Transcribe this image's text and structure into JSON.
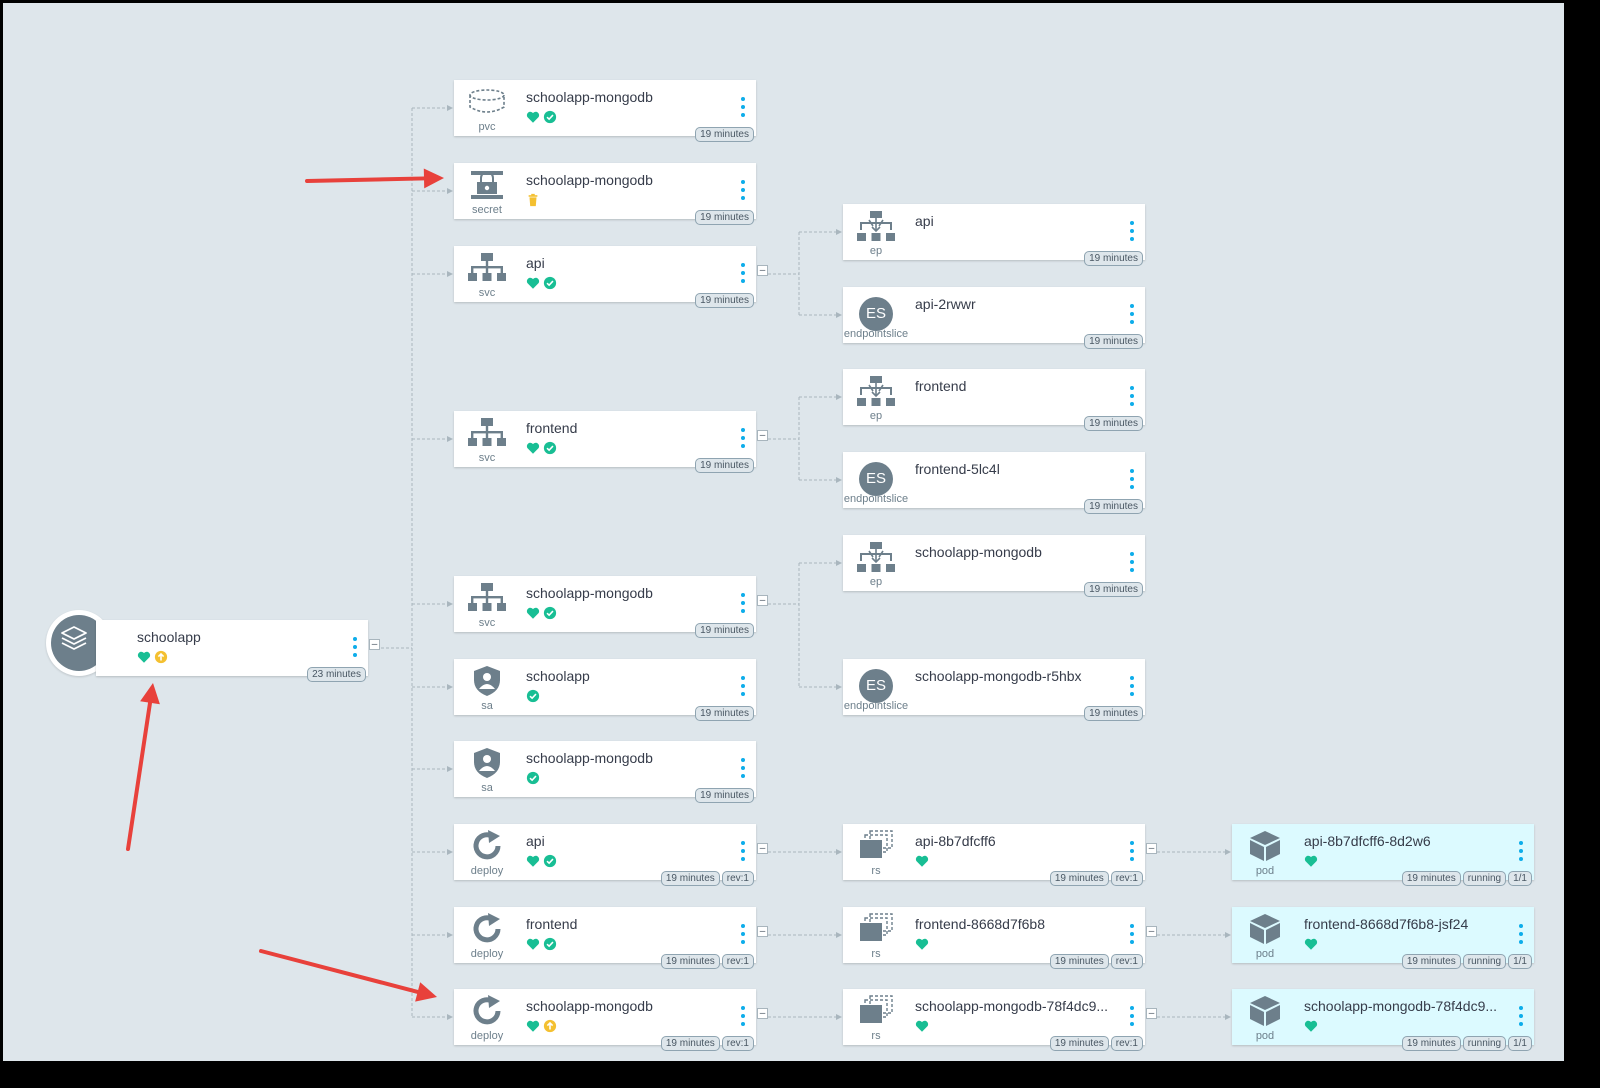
{
  "app": {
    "name": "schoolapp",
    "age": "23 minutes",
    "status": [
      "heart-icon",
      "sync-pending-icon"
    ]
  },
  "nodes": [
    {
      "id": "pvc-mongo",
      "kind": "pvc",
      "name": "schoolapp-mongodb",
      "status": [
        "heart-icon",
        "check-circle-icon"
      ],
      "tags": [
        "19 minutes"
      ]
    },
    {
      "id": "secret-mongo",
      "kind": "secret",
      "name": "schoolapp-mongodb",
      "status": [
        "trash-icon"
      ],
      "tags": [
        "19 minutes"
      ]
    },
    {
      "id": "svc-api",
      "kind": "svc",
      "name": "api",
      "status": [
        "heart-icon",
        "check-circle-icon"
      ],
      "tags": [
        "19 minutes"
      ]
    },
    {
      "id": "ep-api",
      "kind": "ep",
      "name": "api",
      "status": [],
      "tags": [
        "19 minutes"
      ]
    },
    {
      "id": "es-api",
      "kind": "endpointslice",
      "name": "api-2rwwr",
      "status": [],
      "tags": [
        "19 minutes"
      ]
    },
    {
      "id": "svc-frontend",
      "kind": "svc",
      "name": "frontend",
      "status": [
        "heart-icon",
        "check-circle-icon"
      ],
      "tags": [
        "19 minutes"
      ]
    },
    {
      "id": "ep-frontend",
      "kind": "ep",
      "name": "frontend",
      "status": [],
      "tags": [
        "19 minutes"
      ]
    },
    {
      "id": "es-frontend",
      "kind": "endpointslice",
      "name": "frontend-5lc4l",
      "status": [],
      "tags": [
        "19 minutes"
      ]
    },
    {
      "id": "svc-mongo",
      "kind": "svc",
      "name": "schoolapp-mongodb",
      "status": [
        "heart-icon",
        "check-circle-icon"
      ],
      "tags": [
        "19 minutes"
      ]
    },
    {
      "id": "ep-mongo",
      "kind": "ep",
      "name": "schoolapp-mongodb",
      "status": [],
      "tags": [
        "19 minutes"
      ]
    },
    {
      "id": "es-mongo",
      "kind": "endpointslice",
      "name": "schoolapp-mongodb-r5hbx",
      "status": [],
      "tags": [
        "19 minutes"
      ]
    },
    {
      "id": "sa-app",
      "kind": "sa",
      "name": "schoolapp",
      "status": [
        "check-circle-icon"
      ],
      "tags": [
        "19 minutes"
      ]
    },
    {
      "id": "sa-mongo",
      "kind": "sa",
      "name": "schoolapp-mongodb",
      "status": [
        "check-circle-icon"
      ],
      "tags": [
        "19 minutes"
      ]
    },
    {
      "id": "deploy-api",
      "kind": "deploy",
      "name": "api",
      "status": [
        "heart-icon",
        "check-circle-icon"
      ],
      "tags": [
        "19 minutes",
        "rev:1"
      ]
    },
    {
      "id": "rs-api",
      "kind": "rs",
      "name": "api-8b7dfcff6",
      "status": [
        "heart-icon"
      ],
      "tags": [
        "19 minutes",
        "rev:1"
      ]
    },
    {
      "id": "pod-api",
      "kind": "pod",
      "name": "api-8b7dfcff6-8d2w6",
      "status": [
        "heart-icon"
      ],
      "tags": [
        "19 minutes",
        "running",
        "1/1"
      ]
    },
    {
      "id": "deploy-frontend",
      "kind": "deploy",
      "name": "frontend",
      "status": [
        "heart-icon",
        "check-circle-icon"
      ],
      "tags": [
        "19 minutes",
        "rev:1"
      ]
    },
    {
      "id": "rs-frontend",
      "kind": "rs",
      "name": "frontend-8668d7f6b8",
      "status": [
        "heart-icon"
      ],
      "tags": [
        "19 minutes",
        "rev:1"
      ]
    },
    {
      "id": "pod-frontend",
      "kind": "pod",
      "name": "frontend-8668d7f6b8-jsf24",
      "status": [
        "heart-icon"
      ],
      "tags": [
        "19 minutes",
        "running",
        "1/1"
      ]
    },
    {
      "id": "deploy-mongo",
      "kind": "deploy",
      "name": "schoolapp-mongodb",
      "status": [
        "heart-icon",
        "sync-pending-icon"
      ],
      "tags": [
        "19 minutes",
        "rev:1"
      ]
    },
    {
      "id": "rs-mongo",
      "kind": "rs",
      "name": "schoolapp-mongodb-78f4dc9...",
      "status": [
        "heart-icon"
      ],
      "tags": [
        "19 minutes",
        "rev:1"
      ]
    },
    {
      "id": "pod-mongo",
      "kind": "pod",
      "name": "schoolapp-mongodb-78f4dc9...",
      "status": [
        "heart-icon"
      ],
      "tags": [
        "19 minutes",
        "running",
        "1/1"
      ]
    }
  ],
  "colors": {
    "canvas": "#dee6eb",
    "healthy": "#18be94",
    "pending": "#f4c030",
    "icon": "#6d7f8b",
    "menu": "#0dadea",
    "pod_bg": "#dcfaff",
    "annotation_arrow": "#e8413b"
  }
}
